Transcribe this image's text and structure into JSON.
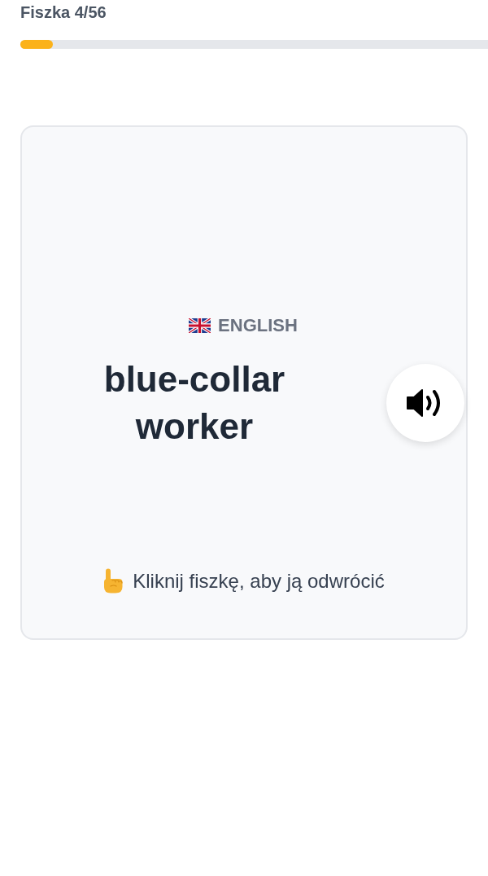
{
  "header": {
    "title": "Fiszka 4/56"
  },
  "progress": {
    "level": 0.07
  },
  "card": {
    "language": "ENGLISH",
    "word": "blue-collar worker",
    "hint": "Kliknij fiszkę, aby ją odwrócić"
  }
}
